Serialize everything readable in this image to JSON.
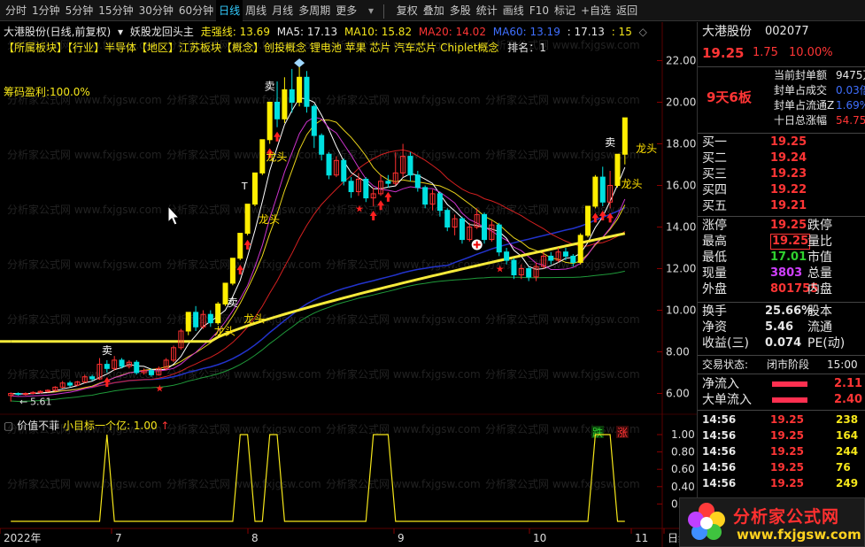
{
  "toolbar": {
    "periods": [
      "分时",
      "1分钟",
      "5分钟",
      "15分钟",
      "30分钟",
      "60分钟",
      "日线",
      "周线",
      "月线",
      "多周期",
      "更多"
    ],
    "more_caret": "▾",
    "tools": [
      "复权",
      "叠加",
      "多股",
      "统计",
      "画线",
      "F10",
      "标记",
      "+自选",
      "返回"
    ]
  },
  "header": {
    "title": "大港股份(日线,前复权)",
    "indicator_name": "妖股龙回头主",
    "strong_line_label": "走强线:",
    "strong_line_value": "13.69",
    "ma5": "MA5: 17.13",
    "ma10": "MA10: 15.82",
    "ma20": "MA20: 14.02",
    "ma60": "MA60: 13.19",
    "other1": ": 17.13",
    "other2": ": 15",
    "diamond": "◇"
  },
  "concepts": "【所属板块】【行业】半导体【地区】江苏板块【概念】创投概念 锂电池 苹果 芯片 汽车芯片 Chiplet概念",
  "rank": "排名：1",
  "chip_profit": "筹码盈利:100.0%",
  "price_axis": [
    "22.00",
    "20.00",
    "18.00",
    "16.00",
    "14.00",
    "12.00",
    "10.00",
    "8.00",
    "6.00"
  ],
  "low_label": "5.61",
  "sub_indicator": {
    "name": "价值不菲",
    "label": "小目标一个亿: 1.00",
    "arrow": "↑",
    "axis": [
      "1.00",
      "0.80",
      "0.60",
      "0.40",
      "0.20"
    ]
  },
  "x_axis": [
    "2022年",
    "7",
    "8",
    "9",
    "10",
    "11",
    "日线"
  ],
  "chart_labels": {
    "sell": "卖",
    "longtou": "龙头",
    "buy_mark": "买",
    "t": "T",
    "die": "跌",
    "zhang": "涨"
  },
  "stock": {
    "name": "大港股份",
    "code": "002077",
    "price": "19.25",
    "change": "1.75",
    "pct": "10.00%"
  },
  "limit_info": {
    "badge": "9天6板",
    "rows": [
      {
        "label": "当前封单额",
        "value": "9475万",
        "color": "#e6e6e6"
      },
      {
        "label": "封单占成交",
        "value": "0.03倍",
        "color": "#3f6fff"
      },
      {
        "label": "封单占流通Z",
        "value": "1.69%",
        "color": "#3f6fff"
      },
      {
        "label": "十日总涨幅",
        "value": "54.75%",
        "color": "#ff3535"
      }
    ]
  },
  "bids": [
    {
      "label": "买一",
      "price": "19.25"
    },
    {
      "label": "买二",
      "price": "19.24"
    },
    {
      "label": "买三",
      "price": "19.23"
    },
    {
      "label": "买四",
      "price": "19.22"
    },
    {
      "label": "买五",
      "price": "19.21"
    }
  ],
  "quote": [
    {
      "l1": "涨停",
      "v1": "19.25",
      "c1": "#ff3535",
      "l2": "跌停"
    },
    {
      "l1": "最高",
      "v1": "19.25",
      "c1": "#ff3535",
      "l2": "量比"
    },
    {
      "l1": "最低",
      "v1": "17.01",
      "c1": "#2fd12f",
      "l2": "市值"
    },
    {
      "l1": "现量",
      "v1": "3803",
      "c1": "#d040ff",
      "l2": "总量"
    },
    {
      "l1": "外盘",
      "v1": "801755",
      "c1": "#ff3535",
      "l2": "内盘"
    }
  ],
  "fund": [
    {
      "l1": "换手",
      "v1": "25.66%",
      "l2": "股本"
    },
    {
      "l1": "净资",
      "v1": "5.46",
      "l2": "流通"
    },
    {
      "l1": "收益(三)",
      "v1": "0.074",
      "l2": "PE(动)"
    }
  ],
  "trade_state": {
    "label": "交易状态:",
    "value": "闭市阶段",
    "time": "15:00"
  },
  "flows": [
    {
      "label": "净流入",
      "value": "2.11"
    },
    {
      "label": "大单流入",
      "value": "2.40"
    }
  ],
  "ticks": [
    {
      "t": "14:56",
      "p": "19.25",
      "v": "238"
    },
    {
      "t": "14:56",
      "p": "19.25",
      "v": "164"
    },
    {
      "t": "14:56",
      "p": "19.25",
      "v": "244"
    },
    {
      "t": "14:56",
      "p": "19.25",
      "v": "76"
    },
    {
      "t": "14:56",
      "p": "19.25",
      "v": "249"
    }
  ],
  "watermark": {
    "cn": "分析家公式网",
    "url": "www.fxjgsw.com",
    "bg_text": "分析家公式网 www.fxjgsw.com"
  },
  "chart_data": {
    "type": "candlestick",
    "ylim": [
      5,
      23
    ],
    "days": [
      {
        "o": 5.9,
        "c": 6.0,
        "h": 6.05,
        "l": 5.61
      },
      {
        "o": 6.0,
        "c": 5.95,
        "h": 6.05,
        "l": 5.9
      },
      {
        "o": 5.95,
        "c": 6.0,
        "h": 6.05,
        "l": 5.9
      },
      {
        "o": 6.0,
        "c": 6.05,
        "h": 6.1,
        "l": 5.95
      },
      {
        "o": 6.05,
        "c": 6.1,
        "h": 6.15,
        "l": 6.0
      },
      {
        "o": 6.1,
        "c": 6.15,
        "h": 6.2,
        "l": 6.05
      },
      {
        "o": 6.15,
        "c": 6.3,
        "h": 6.35,
        "l": 6.1
      },
      {
        "o": 6.3,
        "c": 6.5,
        "h": 6.6,
        "l": 6.25
      },
      {
        "o": 6.5,
        "c": 6.4,
        "h": 6.6,
        "l": 6.3
      },
      {
        "o": 6.4,
        "c": 6.55,
        "h": 6.6,
        "l": 6.35
      },
      {
        "o": 6.55,
        "c": 6.8,
        "h": 6.9,
        "l": 6.5
      },
      {
        "o": 6.8,
        "c": 6.7,
        "h": 6.9,
        "l": 6.6
      },
      {
        "o": 6.7,
        "c": 7.4,
        "h": 7.7,
        "l": 6.65
      },
      {
        "o": 7.4,
        "c": 7.2,
        "h": 7.6,
        "l": 7.0
      },
      {
        "o": 7.2,
        "c": 7.6,
        "h": 7.8,
        "l": 7.1
      },
      {
        "o": 7.6,
        "c": 7.3,
        "h": 7.7,
        "l": 7.2
      },
      {
        "o": 7.3,
        "c": 7.5,
        "h": 7.6,
        "l": 7.2
      },
      {
        "o": 7.5,
        "c": 7.0,
        "h": 7.6,
        "l": 6.9
      },
      {
        "o": 7.0,
        "c": 7.1,
        "h": 7.2,
        "l": 6.9
      },
      {
        "o": 7.1,
        "c": 6.9,
        "h": 7.2,
        "l": 6.8
      },
      {
        "o": 6.9,
        "c": 7.2,
        "h": 7.3,
        "l": 6.85
      },
      {
        "o": 7.2,
        "c": 7.6,
        "h": 7.7,
        "l": 7.1
      },
      {
        "o": 7.6,
        "c": 8.2,
        "h": 8.3,
        "l": 7.5
      },
      {
        "o": 8.2,
        "c": 9.0,
        "h": 9.1,
        "l": 8.1
      },
      {
        "o": 9.0,
        "c": 9.9,
        "h": 9.9,
        "l": 8.8
      },
      {
        "o": 9.9,
        "c": 9.2,
        "h": 10.2,
        "l": 9.0
      },
      {
        "o": 9.2,
        "c": 9.8,
        "h": 10.0,
        "l": 9.1
      },
      {
        "o": 9.8,
        "c": 9.4,
        "h": 10.0,
        "l": 9.2
      },
      {
        "o": 9.4,
        "c": 10.3,
        "h": 10.4,
        "l": 9.3
      },
      {
        "o": 10.3,
        "c": 11.3,
        "h": 11.3,
        "l": 10.2
      },
      {
        "o": 11.3,
        "c": 12.5,
        "h": 12.5,
        "l": 11.2
      },
      {
        "o": 12.5,
        "c": 13.7,
        "h": 13.7,
        "l": 12.4
      },
      {
        "o": 13.7,
        "c": 15.1,
        "h": 15.1,
        "l": 13.6
      },
      {
        "o": 15.1,
        "c": 16.6,
        "h": 16.6,
        "l": 15.0
      },
      {
        "o": 16.6,
        "c": 18.2,
        "h": 18.2,
        "l": 16.5
      },
      {
        "o": 18.2,
        "c": 20.0,
        "h": 20.0,
        "l": 18.0
      },
      {
        "o": 20.0,
        "c": 19.2,
        "h": 21.0,
        "l": 18.8
      },
      {
        "o": 19.2,
        "c": 20.6,
        "h": 21.2,
        "l": 19.0
      },
      {
        "o": 20.6,
        "c": 20.0,
        "h": 21.6,
        "l": 19.5
      },
      {
        "o": 20.0,
        "c": 21.2,
        "h": 21.9,
        "l": 19.8
      },
      {
        "o": 21.2,
        "c": 19.8,
        "h": 21.5,
        "l": 19.5
      },
      {
        "o": 19.8,
        "c": 18.4,
        "h": 19.9,
        "l": 17.8
      },
      {
        "o": 18.4,
        "c": 17.5,
        "h": 18.5,
        "l": 17.2
      },
      {
        "o": 17.5,
        "c": 16.5,
        "h": 17.6,
        "l": 16.3
      },
      {
        "o": 16.5,
        "c": 17.2,
        "h": 17.4,
        "l": 16.4
      },
      {
        "o": 17.2,
        "c": 16.2,
        "h": 17.3,
        "l": 16.0
      },
      {
        "o": 16.2,
        "c": 15.7,
        "h": 16.4,
        "l": 15.4
      },
      {
        "o": 15.7,
        "c": 16.3,
        "h": 16.6,
        "l": 15.5
      },
      {
        "o": 16.3,
        "c": 15.4,
        "h": 16.4,
        "l": 15.2
      },
      {
        "o": 15.4,
        "c": 15.6,
        "h": 15.9,
        "l": 15.0
      },
      {
        "o": 15.6,
        "c": 16.2,
        "h": 16.5,
        "l": 15.5
      },
      {
        "o": 16.2,
        "c": 16.1,
        "h": 16.5,
        "l": 15.9
      },
      {
        "o": 16.1,
        "c": 16.6,
        "h": 17.6,
        "l": 16.0
      },
      {
        "o": 16.6,
        "c": 17.4,
        "h": 18.0,
        "l": 16.4
      },
      {
        "o": 17.4,
        "c": 16.5,
        "h": 17.6,
        "l": 16.2
      },
      {
        "o": 16.5,
        "c": 15.9,
        "h": 16.7,
        "l": 15.7
      },
      {
        "o": 15.9,
        "c": 15.1,
        "h": 16.0,
        "l": 14.9
      },
      {
        "o": 15.1,
        "c": 15.6,
        "h": 15.8,
        "l": 14.8
      },
      {
        "o": 15.6,
        "c": 14.8,
        "h": 15.7,
        "l": 14.5
      },
      {
        "o": 14.8,
        "c": 14.0,
        "h": 14.9,
        "l": 13.8
      },
      {
        "o": 14.0,
        "c": 14.4,
        "h": 14.6,
        "l": 13.6
      },
      {
        "o": 14.4,
        "c": 13.4,
        "h": 14.5,
        "l": 13.2
      },
      {
        "o": 13.4,
        "c": 14.0,
        "h": 14.2,
        "l": 13.3
      },
      {
        "o": 14.0,
        "c": 14.6,
        "h": 14.9,
        "l": 13.9
      },
      {
        "o": 14.6,
        "c": 13.4,
        "h": 14.7,
        "l": 13.2
      },
      {
        "o": 13.4,
        "c": 14.1,
        "h": 14.3,
        "l": 13.3
      },
      {
        "o": 14.1,
        "c": 12.8,
        "h": 14.2,
        "l": 12.6
      },
      {
        "o": 12.8,
        "c": 12.4,
        "h": 13.0,
        "l": 12.2
      },
      {
        "o": 12.4,
        "c": 11.7,
        "h": 12.5,
        "l": 11.5
      },
      {
        "o": 11.7,
        "c": 12.0,
        "h": 12.2,
        "l": 11.5
      },
      {
        "o": 12.0,
        "c": 11.6,
        "h": 12.1,
        "l": 11.4
      },
      {
        "o": 11.6,
        "c": 12.1,
        "h": 12.3,
        "l": 11.4
      },
      {
        "o": 12.1,
        "c": 12.6,
        "h": 12.8,
        "l": 12.0
      },
      {
        "o": 12.6,
        "c": 12.4,
        "h": 12.8,
        "l": 12.2
      },
      {
        "o": 12.4,
        "c": 12.8,
        "h": 13.0,
        "l": 12.3
      },
      {
        "o": 12.8,
        "c": 12.6,
        "h": 13.0,
        "l": 12.4
      },
      {
        "o": 12.6,
        "c": 12.3,
        "h": 12.7,
        "l": 12.1
      },
      {
        "o": 12.3,
        "c": 13.6,
        "h": 13.7,
        "l": 12.2
      },
      {
        "o": 13.6,
        "c": 15.0,
        "h": 15.0,
        "l": 13.5
      },
      {
        "o": 15.0,
        "c": 16.4,
        "h": 16.5,
        "l": 14.9
      },
      {
        "o": 16.4,
        "c": 15.2,
        "h": 16.9,
        "l": 15.0
      },
      {
        "o": 15.2,
        "c": 16.0,
        "h": 16.7,
        "l": 14.9
      },
      {
        "o": 16.0,
        "c": 17.5,
        "h": 17.5,
        "l": 15.9
      },
      {
        "o": 17.5,
        "c": 19.25,
        "h": 19.25,
        "l": 17.01
      }
    ],
    "signal_days": [
      13,
      31,
      32,
      35,
      36,
      49,
      50,
      51,
      79,
      80,
      81
    ]
  }
}
